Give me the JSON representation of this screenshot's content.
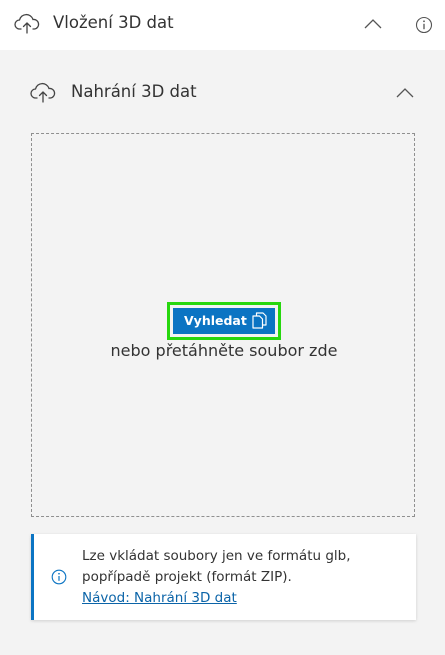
{
  "panel": {
    "title": "Vložení 3D dat",
    "icon": "cloud-upload-icon",
    "collapse_icon": "chevron-up-icon",
    "info_icon": "info-icon"
  },
  "upload_section": {
    "title": "Nahrání 3D dat",
    "icon": "cloud-upload-icon",
    "collapse_icon": "chevron-up-icon",
    "dropzone": {
      "button_label": "Vyhledat",
      "button_icon": "copy-files-icon",
      "drop_hint": "nebo přetáhněte soubor zde"
    }
  },
  "notice": {
    "icon": "info-icon",
    "line1": "Lze vkládat soubory jen ve formátu glb,",
    "line2": "popřípadě projekt (formát ZIP).",
    "link": "Návod: Nahrání 3D dat"
  },
  "colors": {
    "accent": "#0b74c3",
    "focus_outline": "#27d70e",
    "section_bg": "#f3f3f3"
  }
}
